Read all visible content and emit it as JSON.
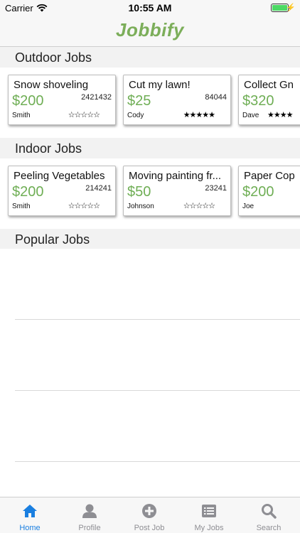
{
  "status_bar": {
    "carrier": "Carrier",
    "time": "10:55 AM"
  },
  "app": {
    "title": "Jobbify",
    "accent_color": "#7cae5a",
    "price_color": "#6fae55"
  },
  "sections": [
    {
      "title": "Outdoor Jobs",
      "jobs": [
        {
          "title": "Snow shoveling",
          "id": "2421432",
          "price": "$200",
          "user": "Smith",
          "stars": "☆☆☆☆☆"
        },
        {
          "title": "Cut my lawn!",
          "id": "84044",
          "price": "$25",
          "user": "Cody",
          "stars": "★★★★★"
        },
        {
          "title": "Collect Gn",
          "id": "",
          "price": "$320",
          "user": "Dave",
          "stars": "★★★★"
        }
      ]
    },
    {
      "title": "Indoor Jobs",
      "jobs": [
        {
          "title": "Peeling Vegetables",
          "id": "214241",
          "price": "$200",
          "user": "Smith",
          "stars": "☆☆☆☆☆"
        },
        {
          "title": "Moving painting fr...",
          "id": "23241",
          "price": "$50",
          "user": "Johnson",
          "stars": "☆☆☆☆☆"
        },
        {
          "title": "Paper Cop",
          "id": "",
          "price": "$200",
          "user": "Joe",
          "stars": ""
        }
      ]
    },
    {
      "title": "Popular Jobs",
      "jobs": []
    }
  ],
  "tabs": [
    {
      "label": "Home",
      "icon": "home-icon",
      "active": true
    },
    {
      "label": "Profile",
      "icon": "person-icon",
      "active": false
    },
    {
      "label": "Post Job",
      "icon": "plus-circle-icon",
      "active": false
    },
    {
      "label": "My Jobs",
      "icon": "list-icon",
      "active": false
    },
    {
      "label": "Search",
      "icon": "search-icon",
      "active": false
    }
  ],
  "colors": {
    "tab_active": "#1a7fe0",
    "tab_inactive": "#8e8e93"
  }
}
